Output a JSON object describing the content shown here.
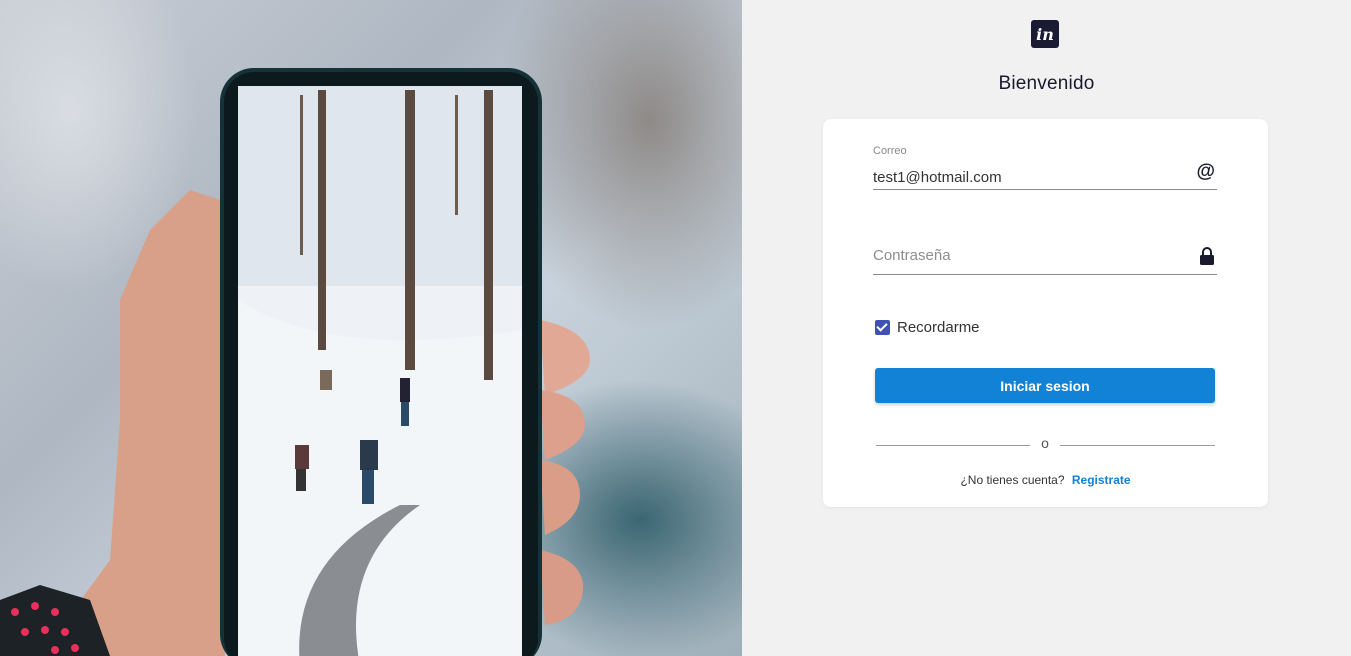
{
  "photo": {
    "alt": "Mano sosteniendo un teléfono que muestra una escena nevada"
  },
  "logo": {
    "text": "in"
  },
  "header": {
    "title": "Bienvenido"
  },
  "form": {
    "email": {
      "label": "Correo",
      "value": "test1@hotmail.com",
      "icon": "at-icon",
      "icon_glyph": "@"
    },
    "password": {
      "placeholder": "Contraseña",
      "icon": "lock-icon"
    },
    "remember": {
      "label": "Recordarme",
      "checked": true
    },
    "submit_label": "Iniciar sesion",
    "divider_text": "o",
    "signup": {
      "prompt": "¿No tienes cuenta?",
      "link_label": "Registrate"
    }
  },
  "colors": {
    "primary": "#1282d6",
    "checkbox": "#3f51b5",
    "logo_bg": "#1a1a33",
    "page_bg": "#f1f1f1"
  }
}
